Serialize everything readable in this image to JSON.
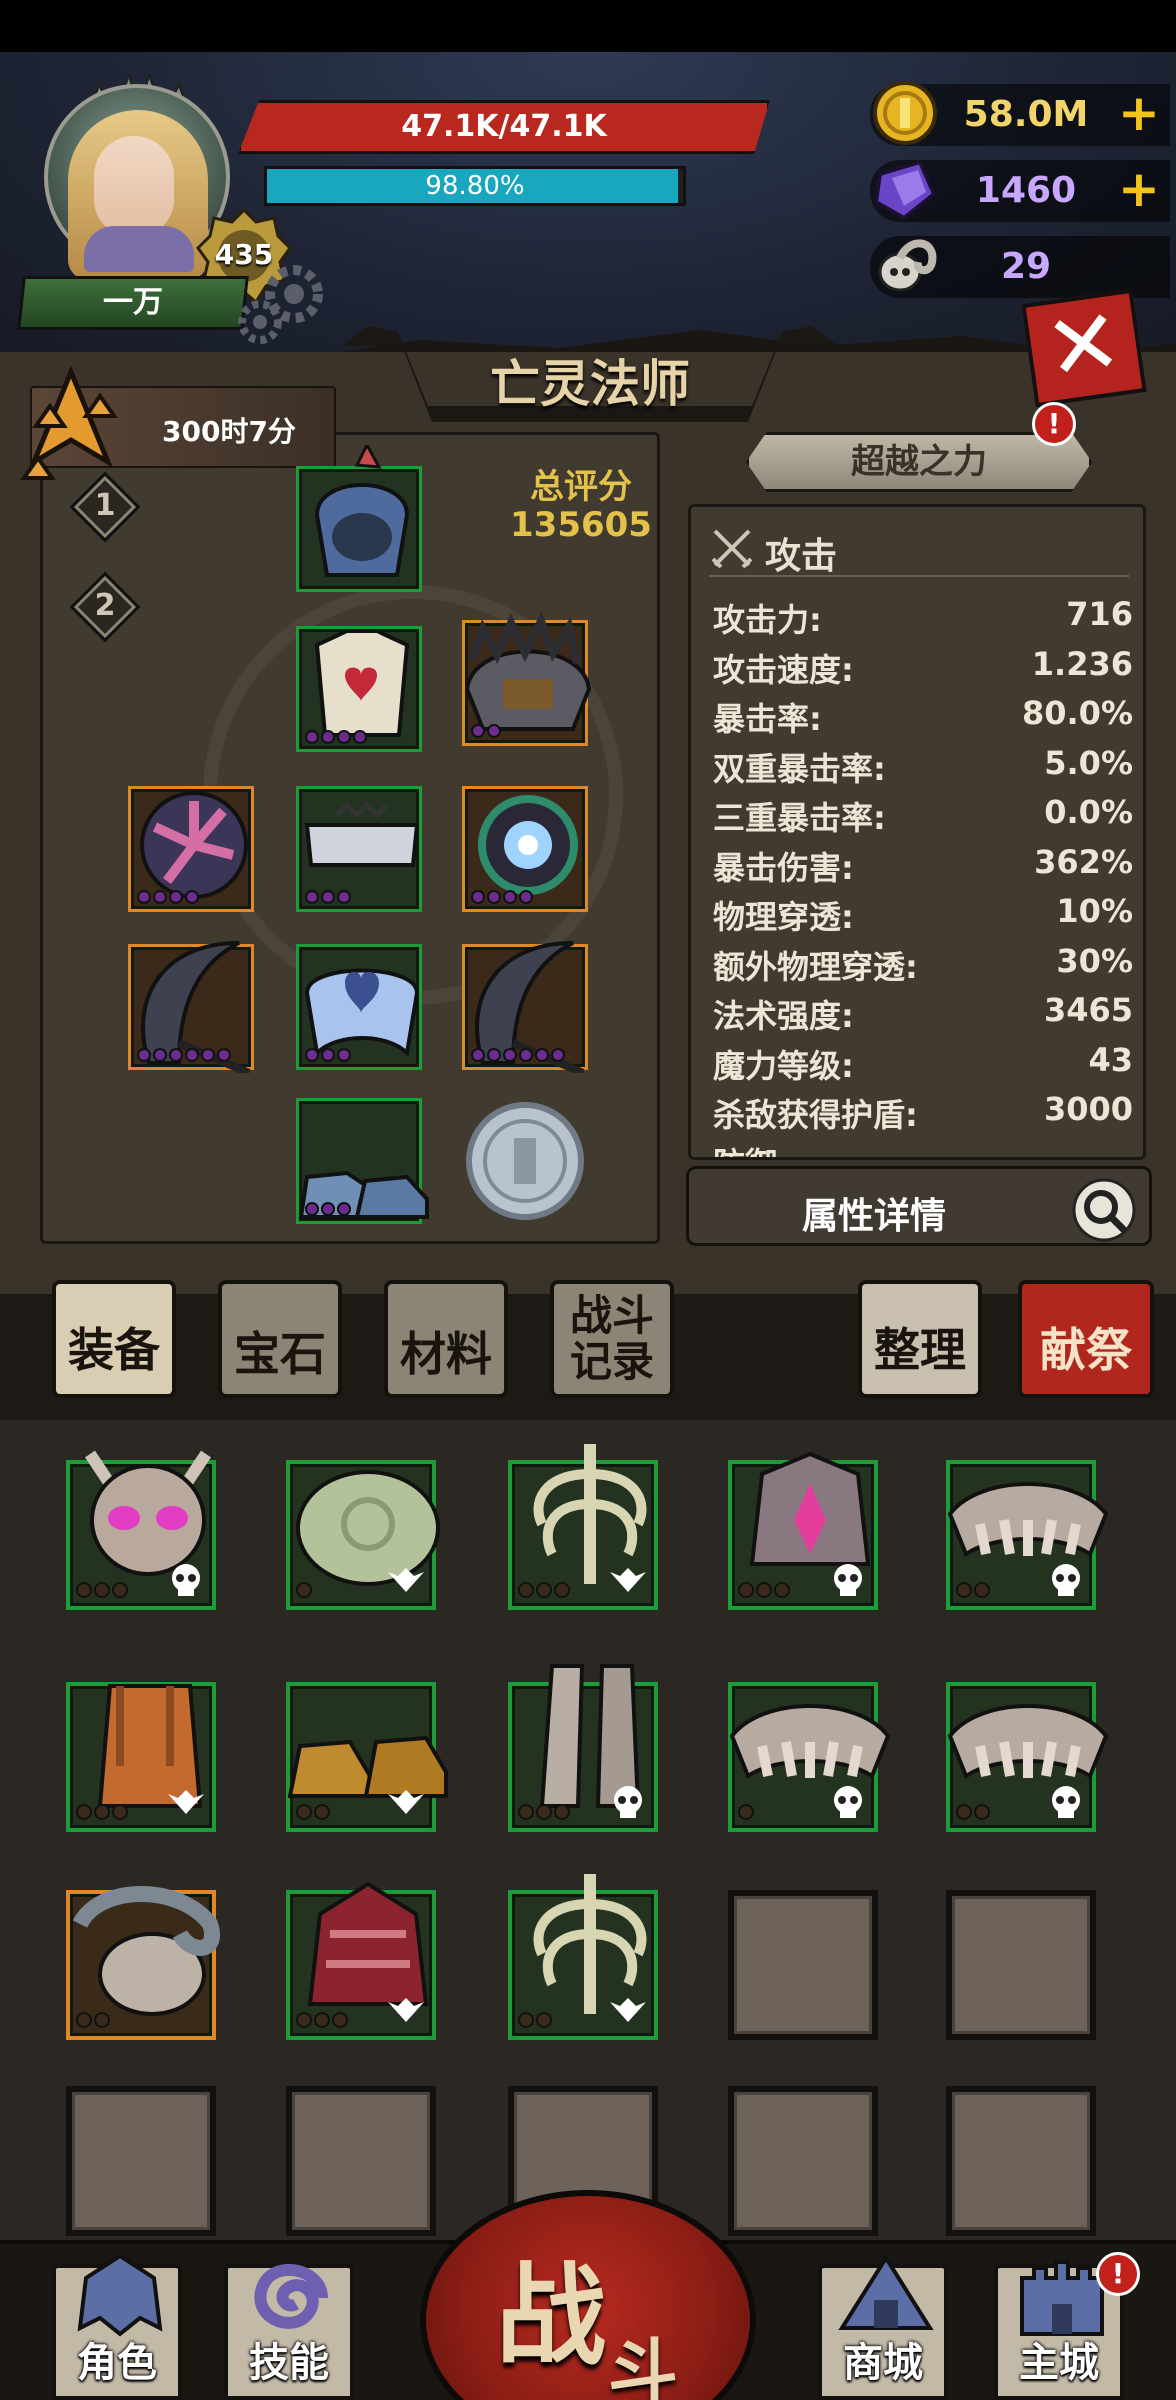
{
  "player": {
    "level": "435",
    "name": "一万",
    "hp_text": "47.1K/47.1K",
    "mp_text": "98.80%",
    "mp_fraction": 0.988
  },
  "currencies": {
    "gold": {
      "value": "58.0M",
      "plus": "+",
      "icon": "gold-coin-icon"
    },
    "gem": {
      "value": "1460",
      "plus": "+",
      "icon": "purple-gem-icon"
    },
    "ram": {
      "value": "29",
      "icon": "ram-skull-icon"
    }
  },
  "main": {
    "title": "亡灵法师",
    "close_label": "✕",
    "timer": "300时7分",
    "preset_1": "1",
    "preset_2": "2",
    "score_label": "总评分",
    "score_value": "135605",
    "aura_button": "超越之力",
    "alert": "!"
  },
  "stats": {
    "section_title": "攻击",
    "rows": [
      {
        "label": "攻击力:",
        "value": "716"
      },
      {
        "label": "攻击速度:",
        "value": "1.236"
      },
      {
        "label": "暴击率:",
        "value": "80.0%"
      },
      {
        "label": "双重暴击率:",
        "value": "5.0%"
      },
      {
        "label": "三重暴击率:",
        "value": "0.0%"
      },
      {
        "label": "暴击伤害:",
        "value": "362%"
      },
      {
        "label": "物理穿透:",
        "value": "10%"
      },
      {
        "label": "额外物理穿透:",
        "value": "30%"
      },
      {
        "label": "法术强度:",
        "value": "3465"
      },
      {
        "label": "魔力等级:",
        "value": "43"
      },
      {
        "label": "杀敌获得护盾:",
        "value": "3000"
      }
    ],
    "next_section_partial": "防御",
    "detail_button": "属性详情"
  },
  "tabs": {
    "equipment": "装备",
    "gems": "宝石",
    "materials": "材料",
    "battle_log_1": "战斗",
    "battle_log_2": "记录",
    "sort": "整理",
    "sacrifice": "献祭"
  },
  "nav": {
    "character": "角色",
    "skills": "技能",
    "fight_1": "战",
    "fight_2": "斗",
    "shop": "商城",
    "city": "主城",
    "alert": "!"
  },
  "colors": {
    "hp": "#b8281e",
    "mp": "#19a7c0",
    "gold_text": "#e3c14a",
    "slot_green": "#1d9c3a",
    "slot_orange": "#e08825",
    "sacrifice_red": "#b0281d"
  }
}
